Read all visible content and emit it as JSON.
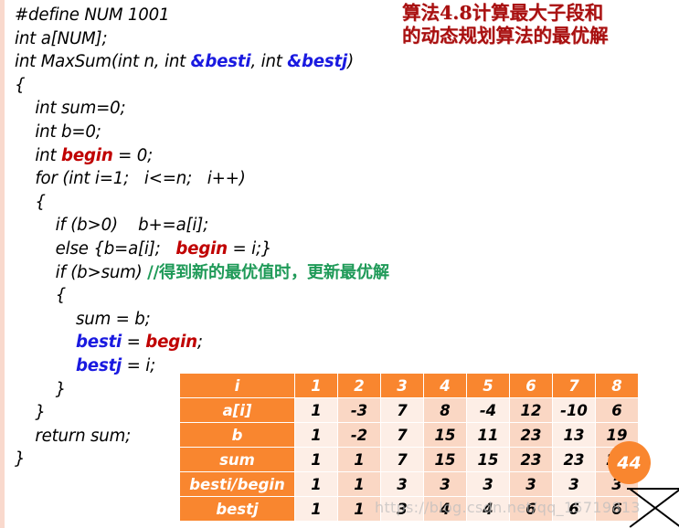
{
  "slide": {
    "page_number": "44",
    "watermark": "https://blog.csdn.net/qq_15719813"
  },
  "title": {
    "line1": "算法4.8计算最大子段和",
    "line2": "的动态规划算法的最优解",
    "color": "#a81010"
  },
  "code": {
    "language": "C++",
    "colors": {
      "default": "#000000",
      "identifier_blue": "#1a1ae0",
      "identifier_red": "#c00000",
      "comment_green": "#1f9a58"
    },
    "lines": [
      {
        "id": "l01",
        "indent": 0,
        "text": "#define NUM 1001"
      },
      {
        "id": "l02",
        "indent": 0,
        "text": "int a[NUM];"
      },
      {
        "id": "l03",
        "indent": 0,
        "pre": "int MaxSum(int n, int ",
        "blue1": "&besti",
        "mid1": ", int ",
        "blue2": "&bestj",
        "post": ")"
      },
      {
        "id": "l04",
        "indent": 0,
        "text": "{"
      },
      {
        "id": "l05",
        "indent": 1,
        "text": "int sum=0;"
      },
      {
        "id": "l06",
        "indent": 1,
        "text": "int b=0;"
      },
      {
        "id": "l07",
        "indent": 1,
        "pre": "int ",
        "red1": "begin",
        "post": " = 0;"
      },
      {
        "id": "l08",
        "indent": 1,
        "text": "for (int i=1;   i<=n;   i++)"
      },
      {
        "id": "l09",
        "indent": 1,
        "text": "{"
      },
      {
        "id": "l10",
        "indent": 2,
        "text": "if (b>0)    b+=a[i];"
      },
      {
        "id": "l11",
        "indent": 2,
        "pre": "else {b=a[i];   ",
        "red1": "begin",
        "post": " = i;}"
      },
      {
        "id": "l12",
        "indent": 2,
        "pre": "if (b>sum) ",
        "comment": "//得到新的最优值时，更新最优解"
      },
      {
        "id": "l13",
        "indent": 2,
        "text": "{"
      },
      {
        "id": "l14",
        "indent": 3,
        "text": "sum = b;"
      },
      {
        "id": "l15",
        "indent": 3,
        "blue1": "besti",
        "mid1": " = ",
        "red1": "begin",
        "post": ";"
      },
      {
        "id": "l16",
        "indent": 3,
        "blue1": "bestj",
        "post": " = i;"
      },
      {
        "id": "l17",
        "indent": 2,
        "text": "}"
      },
      {
        "id": "l18",
        "indent": 1,
        "text": "}"
      },
      {
        "id": "l19",
        "indent": 1,
        "text": "return sum;"
      },
      {
        "id": "l20",
        "indent": 0,
        "text": "}"
      }
    ]
  },
  "table": {
    "header_color": "#f9862f",
    "cell_color_a": "#fdeee6",
    "cell_color_b": "#fad7c4",
    "corner_label": "i",
    "columns": [
      "1",
      "2",
      "3",
      "4",
      "5",
      "6",
      "7",
      "8"
    ],
    "rows": [
      {
        "label": "a[i]",
        "values": [
          "1",
          "-3",
          "7",
          "8",
          "-4",
          "12",
          "-10",
          "6"
        ]
      },
      {
        "label": "b",
        "values": [
          "1",
          "-2",
          "7",
          "15",
          "11",
          "23",
          "13",
          "19"
        ]
      },
      {
        "label": "sum",
        "values": [
          "1",
          "1",
          "7",
          "15",
          "15",
          "23",
          "23",
          "23"
        ]
      },
      {
        "label": "besti/begin",
        "values": [
          "1",
          "1",
          "3",
          "3",
          "3",
          "3",
          "3",
          "3"
        ]
      },
      {
        "label": "bestj",
        "values": [
          "1",
          "1",
          "3",
          "4",
          "4",
          "6",
          "6",
          "6"
        ]
      }
    ]
  }
}
